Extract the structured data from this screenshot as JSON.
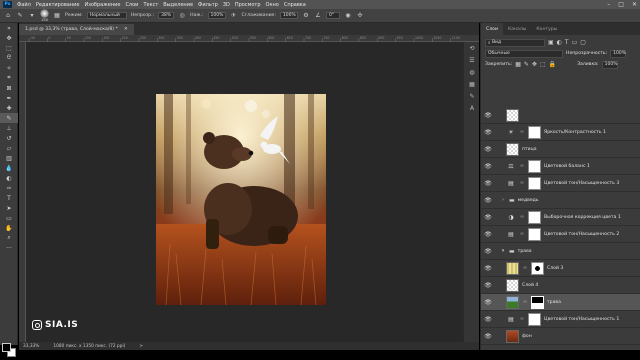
{
  "menu": {
    "logo": "Ps",
    "items": [
      "Файл",
      "Редактирование",
      "Изображение",
      "Слои",
      "Текст",
      "Выделение",
      "Фильтр",
      "3D",
      "Просмотр",
      "Окно",
      "Справка"
    ],
    "window_controls": [
      "–",
      "□",
      "✕"
    ]
  },
  "options_bar": {
    "brush_size": "150",
    "mode_label": "Режим:",
    "mode_value": "Нормальный",
    "opacity_label": "Непрозр.:",
    "opacity_value": "38%",
    "flow_label": "Наж.:",
    "flow_value": "100%",
    "smoothing_label": "Сглаживание:",
    "smoothing_value": "100%",
    "angle_value": "0°"
  },
  "document": {
    "tab_title": "1.psd @ 33,3% (трава, Слой-маска/8) *",
    "close": "✕",
    "ruler_ticks": [
      "-50",
      "0",
      "50",
      "100",
      "150",
      "200",
      "250",
      "300",
      "350",
      "400",
      "450",
      "500",
      "550",
      "600",
      "650",
      "700",
      "750",
      "800",
      "850",
      "900",
      "950",
      "1000",
      "1050",
      "1100"
    ]
  },
  "status": {
    "zoom": "33,33%",
    "doc_info": "1080 пикс. x 1350 пикс. (72 ppi)",
    "arrow": ">"
  },
  "watermark": {
    "text": "SIA.IS"
  },
  "panel": {
    "tabs": [
      "Слои",
      "Каналы",
      "Контуры"
    ],
    "active_tab": "Слои",
    "filter_kind": "Вид",
    "blend_mode": "Обычные",
    "opacity_label": "Непрозрачность:",
    "opacity_value": "100%",
    "lock_label": "Закрепить:",
    "fill_label": "Заливка:",
    "fill_value": "100%"
  },
  "layers": [
    {
      "name": "",
      "type": "checker",
      "visible": true
    },
    {
      "name": "Яркость/Контрастность 1",
      "type": "adjustment",
      "icon": "☀",
      "visible": true
    },
    {
      "name": "птица",
      "type": "checker",
      "visible": true
    },
    {
      "name": "Цветовой баланс 1",
      "type": "adjustment",
      "icon": "⚖",
      "visible": true
    },
    {
      "name": "Цветовой тон/Насыщенность 3",
      "type": "adjustment",
      "icon": "▤",
      "visible": true
    },
    {
      "name": "медведь",
      "type": "group",
      "visible": true
    },
    {
      "name": "Выборочная коррекция цвета 1",
      "type": "adjustment",
      "icon": "◑",
      "visible": true
    },
    {
      "name": "Цветовой тон/Насыщенность 2",
      "type": "adjustment",
      "icon": "▤",
      "visible": true
    },
    {
      "name": "трава",
      "type": "group-open",
      "visible": true
    },
    {
      "name": "Слой 3",
      "type": "grass-mask",
      "visible": true
    },
    {
      "name": "Слой 4",
      "type": "checker",
      "visible": true
    },
    {
      "name": "трава",
      "type": "photo-mask",
      "visible": true,
      "selected": true
    },
    {
      "name": "Цветовой тон/Насыщенность 1",
      "type": "adjustment",
      "icon": "▤",
      "visible": true
    },
    {
      "name": "фон",
      "type": "photo",
      "visible": true
    }
  ],
  "colors": {
    "app_bg": "#282828",
    "panel_bg": "#3b3b3b",
    "selected_layer": "#565656",
    "foreground": "#000000",
    "background": "#ffffff"
  }
}
